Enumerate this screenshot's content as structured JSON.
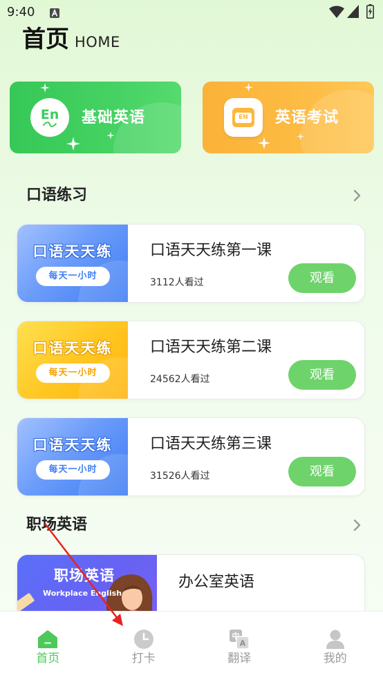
{
  "status_bar": {
    "time": "9:40",
    "notification_icon": "a-notification-icon",
    "right_icons": [
      "wifi-icon",
      "signal-icon",
      "battery-charging-icon"
    ]
  },
  "header": {
    "title": "首页",
    "subtitle": "HOME"
  },
  "feature_cards": [
    {
      "label": "基础英语",
      "icon": "en-circle-icon",
      "icon_text": "En",
      "color": "#3ccd5c"
    },
    {
      "label": "英语考试",
      "icon": "en-book-icon",
      "icon_text": "EN",
      "color": "#fdb73d"
    }
  ],
  "sections": [
    {
      "title": "口语练习",
      "more_icon": "chevron-right-icon",
      "lessons": [
        {
          "thumb_title": "口语天天练",
          "thumb_pill": "每天一小时",
          "thumb_color": "#5a90f8",
          "title": "口语天天练第一课",
          "views": "3112人看过",
          "button": "观看"
        },
        {
          "thumb_title": "口语天天练",
          "thumb_pill": "每天一小时",
          "thumb_color": "#ffc21c",
          "title": "口语天天练第二课",
          "views": "24562人看过",
          "button": "观看"
        },
        {
          "thumb_title": "口语天天练",
          "thumb_pill": "每天一小时",
          "thumb_color": "#5a90f8",
          "title": "口语天天练第三课",
          "views": "31526人看过",
          "button": "观看"
        }
      ]
    },
    {
      "title": "职场英语",
      "more_icon": "chevron-right-icon",
      "lessons": [
        {
          "thumb_title": "职场英语",
          "thumb_subtitle": "Workplace English",
          "thumb_color": "#6762f3",
          "title": "办公室英语"
        }
      ]
    }
  ],
  "nav": {
    "items": [
      {
        "label": "首页",
        "icon": "home-icon",
        "active": true
      },
      {
        "label": "打卡",
        "icon": "clock-icon",
        "active": false
      },
      {
        "label": "翻译",
        "icon": "translate-icon",
        "active": false,
        "icon_glyphs": [
          "中",
          "A"
        ]
      },
      {
        "label": "我的",
        "icon": "user-icon",
        "active": false
      }
    ]
  },
  "theme": {
    "accent": "#4cc95a",
    "watch_button": "#6fd36b",
    "annotation_arrow": "#e8231f"
  }
}
